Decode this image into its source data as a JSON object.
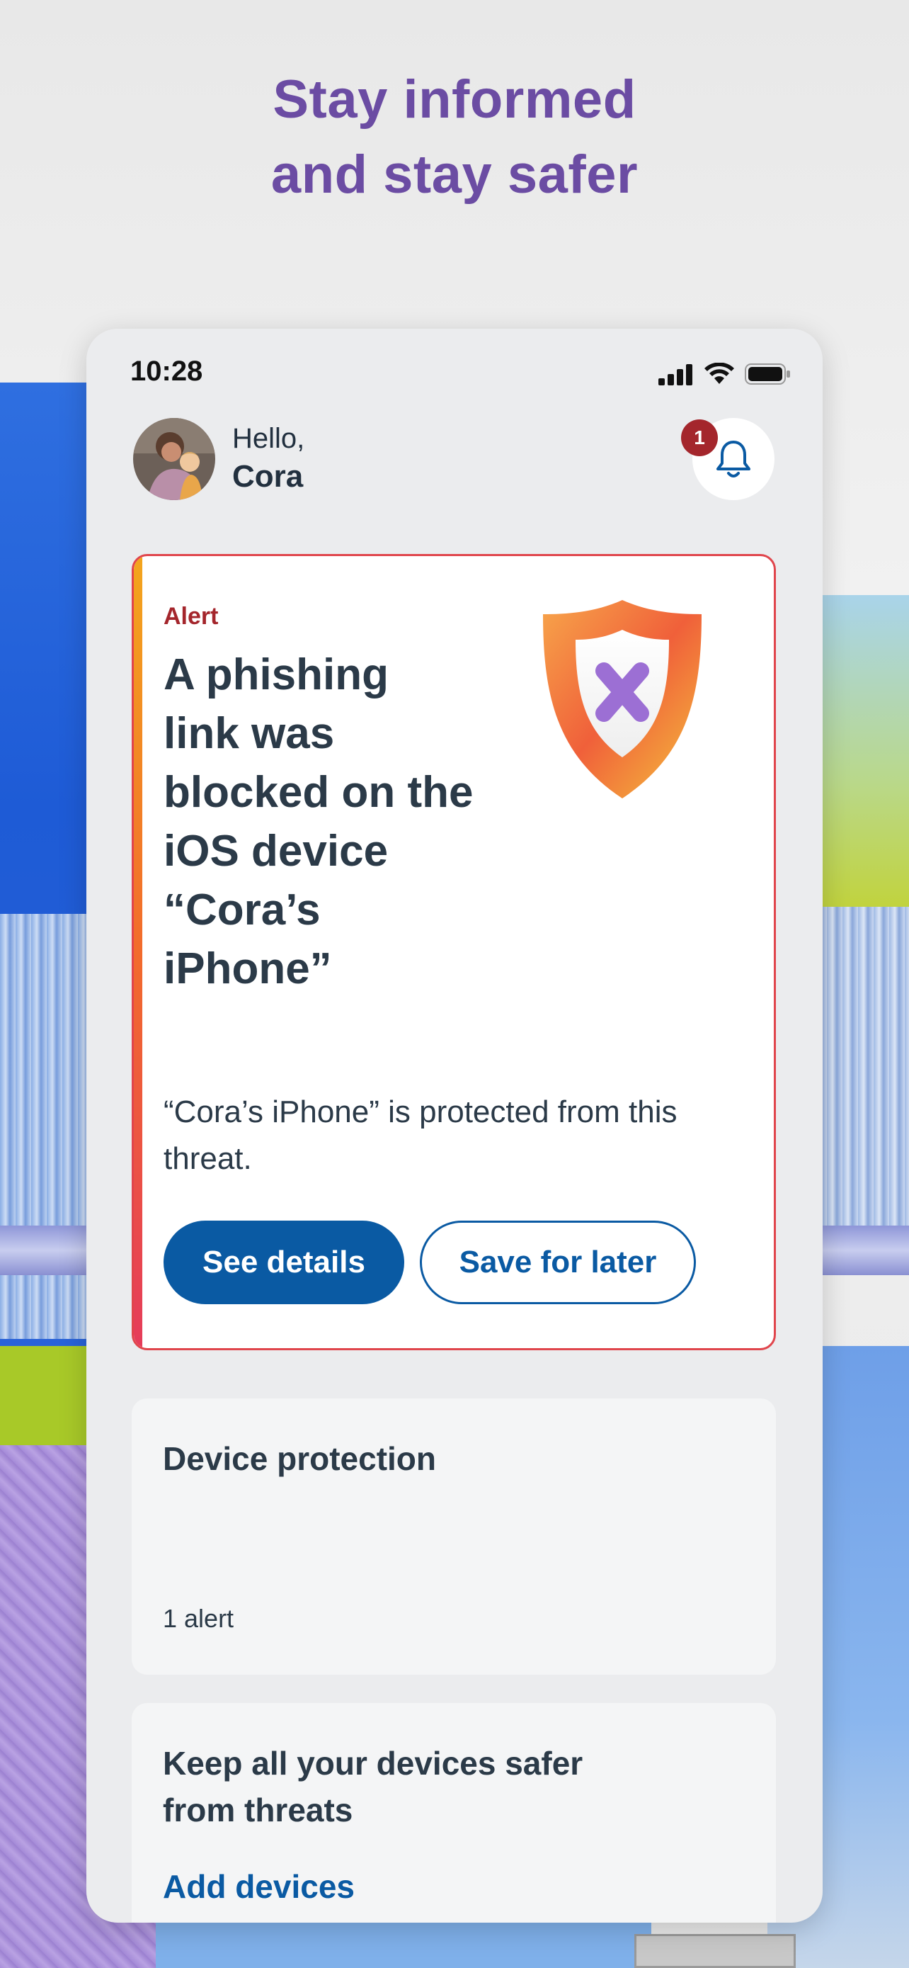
{
  "headline": {
    "line1": "Stay informed",
    "line2": "and stay safer"
  },
  "status_bar": {
    "time": "10:28",
    "icons": [
      "cellular-signal-icon",
      "wifi-icon",
      "battery-icon"
    ]
  },
  "greeting": {
    "hello": "Hello,",
    "name": "Cora"
  },
  "notifications": {
    "badge_count": "1",
    "icon": "bell-icon"
  },
  "alert_card": {
    "kicker": "Alert",
    "title": "A phishing link was blocked on the iOS device “Cora’s iPhone”",
    "body": "“Cora’s iPhone” is protected from this threat.",
    "primary_button": "See details",
    "secondary_button": "Save for later",
    "illustration": "shield-x-icon",
    "accent_color": "#a4262c",
    "border_color": "#e0454c"
  },
  "cards": {
    "device_protection": {
      "title": "Device protection",
      "meta": "1 alert"
    },
    "add_devices": {
      "title": "Keep all your devices safer from threats",
      "link": "Add devices"
    }
  },
  "colors": {
    "headline": "#6b4ca3",
    "primary": "#0a5aa3",
    "text": "#2b3a48",
    "badge": "#a4262c"
  }
}
